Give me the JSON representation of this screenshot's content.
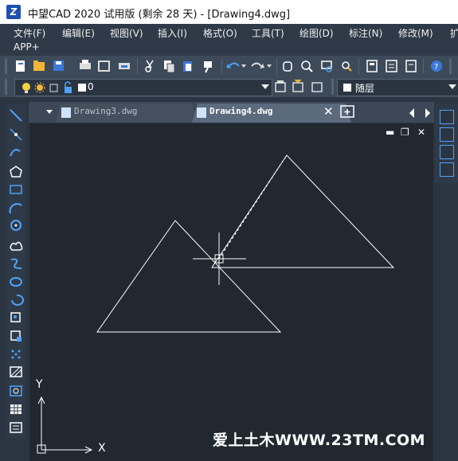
{
  "window": {
    "title": "中望CAD 2020 试用版 (剩余 28 天) - [Drawing4.dwg]",
    "logo_text": "Z"
  },
  "menu": {
    "items": [
      "文件(F)",
      "编辑(E)",
      "视图(V)",
      "插入(I)",
      "格式(O)",
      "工具(T)",
      "绘图(D)",
      "标注(N)",
      "修改(M)",
      "扩"
    ],
    "second_row": "APP+"
  },
  "layer": {
    "current": "0"
  },
  "color_combo": {
    "value": "随层"
  },
  "tabs": [
    {
      "label": "Drawing3.dwg",
      "active": false
    },
    {
      "label": "Drawing4.dwg",
      "active": true
    }
  ],
  "canvas": {
    "axis_x": "X",
    "axis_y": "Y",
    "watermark": "爱上土木WWW.23TM.COM"
  },
  "colors": {
    "menubar_bg": "#2f3a48",
    "canvas_bg": "#212830",
    "accent": "#4fa3f7"
  }
}
